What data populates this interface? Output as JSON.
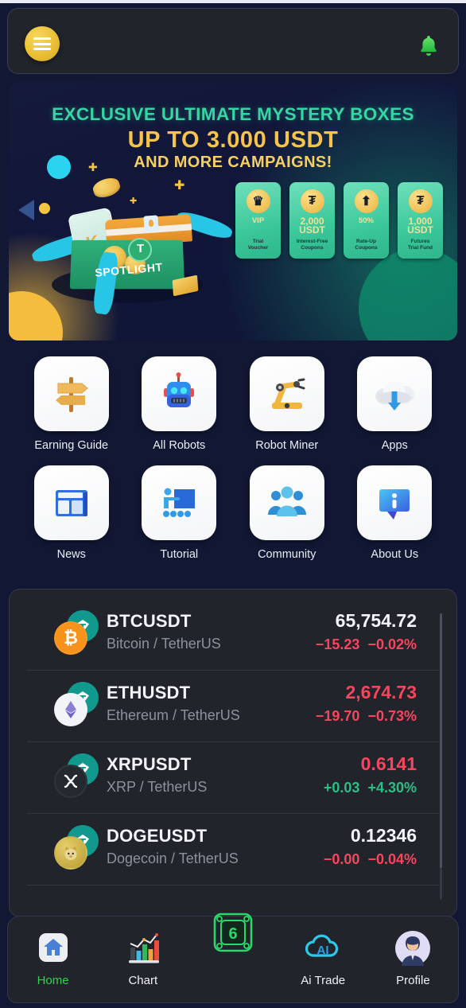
{
  "header": {
    "menu_icon": "hamburger-menu-icon",
    "bell_icon": "notification-bell-icon"
  },
  "banner": {
    "title": "EXCLUSIVE ULTIMATE MYSTERY BOXES",
    "subtitle_amount": "UP TO 3.000 USDT",
    "subtitle_more": "AND MORE CAMPAIGNS!",
    "box_label": "SPOTLIGHT",
    "vouchers": [
      {
        "icon": "crown-coin-icon",
        "glyph": "♛",
        "amount": "VIP",
        "amount_big": false,
        "desc": "Trial\nVoucher"
      },
      {
        "icon": "tether-coin-icon",
        "glyph": "₮",
        "amount": "2,000\nUSDT",
        "amount_big": true,
        "desc": "Interest-Free\nCoupons"
      },
      {
        "icon": "arrow-up-coin-icon",
        "glyph": "⬆",
        "amount": "50%",
        "amount_big": false,
        "desc": "Rate-Up\nCoupons"
      },
      {
        "icon": "tether-coin-icon",
        "glyph": "₮",
        "amount": "1,000\nUSDT",
        "amount_big": true,
        "desc": "Futures\nTrial Fund"
      }
    ]
  },
  "grid": {
    "items": [
      {
        "label": "Earning Guide",
        "icon": "signpost-icon"
      },
      {
        "label": "All Robots",
        "icon": "robot-icon"
      },
      {
        "label": "Robot Miner",
        "icon": "robot-arm-icon"
      },
      {
        "label": "Apps",
        "icon": "cloud-download-icon"
      },
      {
        "label": "News",
        "icon": "newspaper-icon"
      },
      {
        "label": "Tutorial",
        "icon": "presentation-icon"
      },
      {
        "label": "Community",
        "icon": "people-group-icon"
      },
      {
        "label": "About Us",
        "icon": "info-bubble-icon"
      }
    ]
  },
  "tickers": {
    "rows": [
      {
        "symbol": "BTCUSDT",
        "names": "Bitcoin / TetherUS",
        "price": "65,754.72",
        "price_dir": "neutral",
        "change_abs": "−15.23",
        "change_pct": "−0.02%",
        "change_dir": "down",
        "coin_icon": "bitcoin-icon",
        "coin_glyph": "₿",
        "coin_bg": "#f7931a",
        "coin_fg": "#ffffff"
      },
      {
        "symbol": "ETHUSDT",
        "names": "Ethereum / TetherUS",
        "price": "2,674.73",
        "price_dir": "down",
        "change_abs": "−19.70",
        "change_pct": "−0.73%",
        "change_dir": "down",
        "coin_icon": "ethereum-icon",
        "coin_glyph": "⧫",
        "coin_bg": "#f3f4f8",
        "coin_fg": "#8a7fd4"
      },
      {
        "symbol": "XRPUSDT",
        "names": "XRP / TetherUS",
        "price": "0.6141",
        "price_dir": "down",
        "change_abs": "+0.03",
        "change_pct": "+4.30%",
        "change_dir": "up",
        "coin_icon": "xrp-icon",
        "coin_glyph": "✕",
        "coin_bg": "#23292f",
        "coin_fg": "#ffffff"
      },
      {
        "symbol": "DOGEUSDT",
        "names": "Dogecoin / TetherUS",
        "price": "0.12346",
        "price_dir": "neutral",
        "change_abs": "−0.00",
        "change_pct": "−0.04%",
        "change_dir": "down",
        "coin_icon": "dogecoin-icon",
        "coin_glyph": "Ð",
        "coin_bg": "#c3a634",
        "coin_fg": "#ffffff"
      }
    ]
  },
  "bottom_nav": {
    "items": [
      {
        "label": "Home",
        "icon": "home-icon",
        "active": true
      },
      {
        "label": "Chart",
        "icon": "bar-chart-icon",
        "active": false
      },
      {
        "label": "Ai Trade",
        "icon": "cloud-ai-icon",
        "active": false
      },
      {
        "label": "Profile",
        "icon": "user-avatar-icon",
        "active": false
      }
    ],
    "center": {
      "icon": "cpu-chip-icon",
      "glyph": "6"
    }
  },
  "colors": {
    "accent_green": "#2fd14f",
    "down_red": "#f6465d",
    "up_green": "#2ebd85",
    "gold": "#f6c44a",
    "banner_teal": "#35d6a4"
  }
}
